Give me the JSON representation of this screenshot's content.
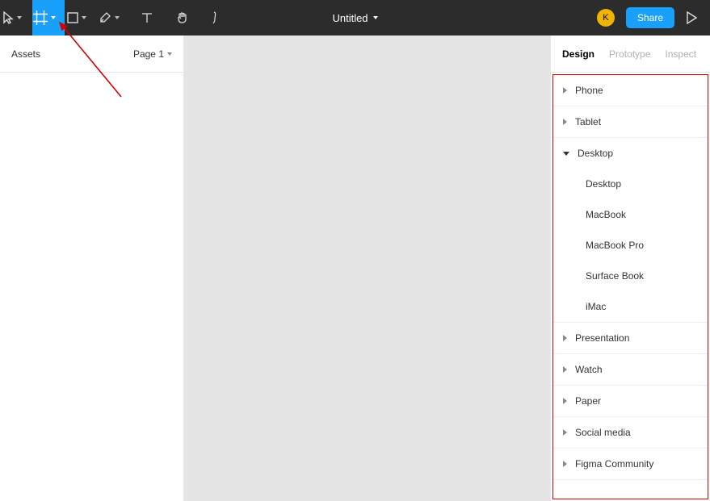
{
  "toolbar": {
    "file_title": "Untitled",
    "avatar_initial": "K",
    "share_label": "Share"
  },
  "left_panel": {
    "tab_assets": "Assets",
    "page_label": "Page 1"
  },
  "right_panel": {
    "tabs": {
      "design": "Design",
      "prototype": "Prototype",
      "inspect": "Inspect"
    }
  },
  "frame_presets": {
    "groups": [
      {
        "name": "Phone",
        "expanded": false,
        "items": []
      },
      {
        "name": "Tablet",
        "expanded": false,
        "items": []
      },
      {
        "name": "Desktop",
        "expanded": true,
        "items": [
          "Desktop",
          "MacBook",
          "MacBook Pro",
          "Surface Book",
          "iMac"
        ]
      },
      {
        "name": "Presentation",
        "expanded": false,
        "items": []
      },
      {
        "name": "Watch",
        "expanded": false,
        "items": []
      },
      {
        "name": "Paper",
        "expanded": false,
        "items": []
      },
      {
        "name": "Social media",
        "expanded": false,
        "items": []
      },
      {
        "name": "Figma Community",
        "expanded": false,
        "items": []
      }
    ]
  },
  "colors": {
    "accent": "#18a0fb",
    "toolbar_bg": "#2c2c2c",
    "canvas_bg": "#e5e5e5",
    "annotation": "#d60000"
  }
}
